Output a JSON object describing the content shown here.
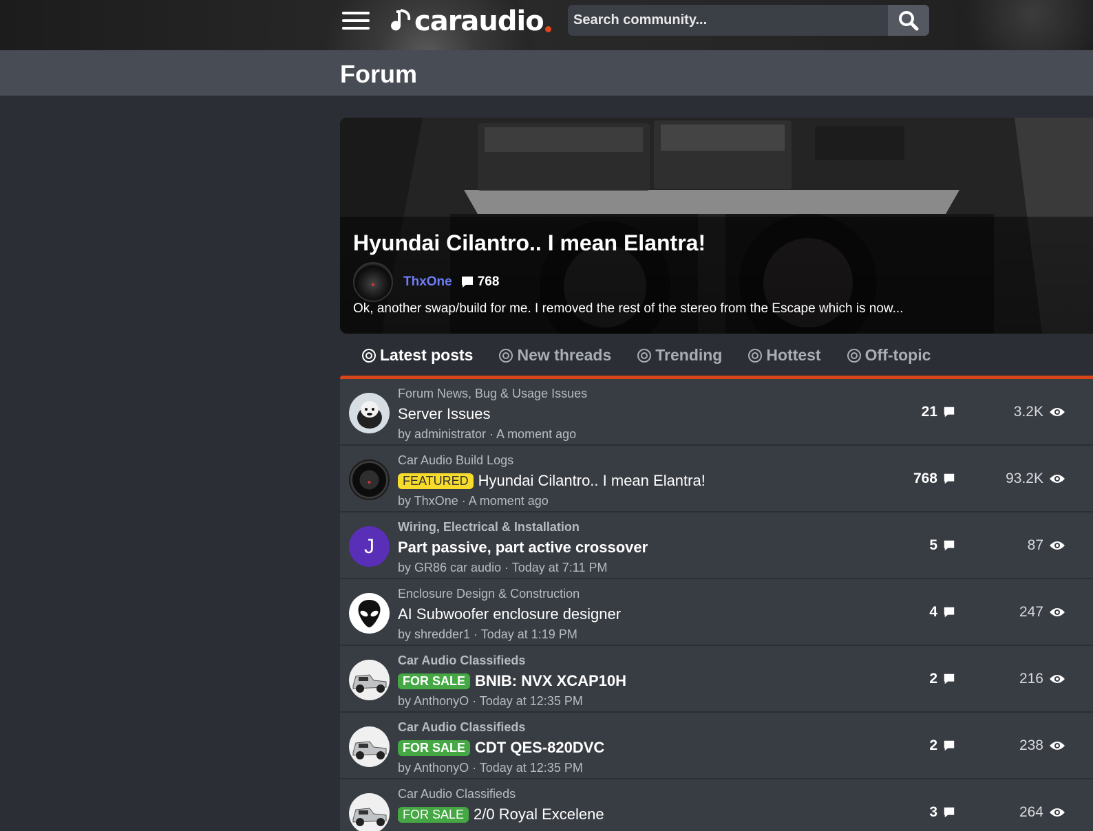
{
  "header": {
    "logo_text": "caraudio",
    "search_placeholder": "Search community..."
  },
  "page_title": "Forum",
  "featured": {
    "title": "Hyundai Cilantro.. I mean Elantra!",
    "author": "ThxOne",
    "comment_count": "768",
    "snippet": "Ok, another swap/build for me. I removed the rest of the stereo from the Escape which is now..."
  },
  "tabs": [
    {
      "label": "Latest posts",
      "active": true
    },
    {
      "label": "New threads",
      "active": false
    },
    {
      "label": "Trending",
      "active": false
    },
    {
      "label": "Hottest",
      "active": false
    },
    {
      "label": "Off-topic",
      "active": false
    }
  ],
  "threads": [
    {
      "category": "Forum News, Bug & Usage Issues",
      "tag": "",
      "title": "Server Issues",
      "byline": "by administrator · A moment ago",
      "replies": "21",
      "views": "3.2K",
      "avatar": "dog-avatar"
    },
    {
      "category": "Car Audio Build Logs",
      "tag": "FEATURED",
      "title": "Hyundai Cilantro.. I mean Elantra!",
      "byline": "by ThxOne · A moment ago",
      "replies": "768",
      "views": "93.2K",
      "avatar": "subwoofer-avatar"
    },
    {
      "category": "Wiring, Electrical & Installation",
      "tag": "",
      "title": "Part passive, part active crossover",
      "byline": "by GR86 car audio · Today at 7:11 PM",
      "replies": "5",
      "views": "87",
      "avatar": "letter-avatar",
      "avatar_letter": "J"
    },
    {
      "category": "Enclosure Design & Construction",
      "tag": "",
      "title": "AI Subwoofer enclosure designer",
      "byline": "by shredder1 · Today at 1:19 PM",
      "replies": "4",
      "views": "247",
      "avatar": "alien-avatar"
    },
    {
      "category": "Car Audio Classifieds",
      "tag": "FOR SALE",
      "title": "BNIB: NVX XCAP10H",
      "byline": "by AnthonyO · Today at 12:35 PM",
      "replies": "2",
      "views": "216",
      "avatar": "truck-avatar"
    },
    {
      "category": "Car Audio Classifieds",
      "tag": "FOR SALE",
      "title": "CDT QES-820DVC",
      "byline": "by AnthonyO · Today at 12:35 PM",
      "replies": "2",
      "views": "238",
      "avatar": "truck-avatar"
    },
    {
      "category": "Car Audio Classifieds",
      "tag": "FOR SALE",
      "title": "2/0 Royal Excelene",
      "byline": "",
      "replies": "3",
      "views": "264",
      "avatar": "truck-avatar"
    }
  ],
  "colors": {
    "accent": "#d7461a",
    "link": "#6e7cf6",
    "featured_tag": "#f7dc2c",
    "sale_tag": "#45a844"
  }
}
